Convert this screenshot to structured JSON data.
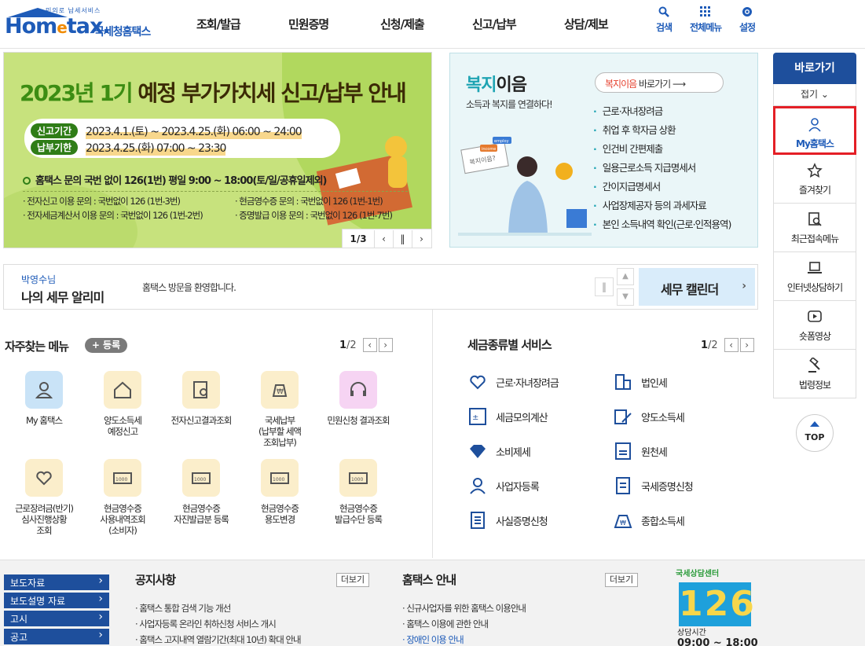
{
  "header": {
    "logo_word_a": "Hom",
    "logo_word_e": "e",
    "logo_word_b": "tax.",
    "logo_tagline": "민의로 납세서비스",
    "logo_ko": "국세청홈택스",
    "gnb": [
      "조회/발급",
      "민원증명",
      "신청/제출",
      "신고/납부",
      "상담/제보"
    ],
    "util": [
      {
        "label": "검색",
        "icon": "search-icon"
      },
      {
        "label": "전체메뉴",
        "icon": "grid-icon"
      },
      {
        "label": "설정",
        "icon": "gear-icon"
      }
    ]
  },
  "banner": {
    "headline_a": "2023년 1기",
    "headline_b": " 예정 부가가치세 신고/납부 안내",
    "report_label": "신고기간",
    "report_value": "2023.4.1.(토) ~ 2023.4.25.(화) 06:00 ~ 24:00",
    "pay_label": "납부기한",
    "pay_value": "2023.4.25.(화) 07:00 ~ 23:30",
    "contact": "홈택스 문의 국번 없이 126(1번) 평일 9:00 ~ 18:00(토/일/공휴일제외)",
    "lines": [
      "· 전자신고 이용 문의 : 국번없이 126 (1번-3번)",
      "· 현금영수증 문의 : 국번없이 126 (1번-1번)",
      "· 전자세금계산서 이용 문의 : 국번없이 126 (1번-2번)",
      "· 증명발급 이용 문의 : 국번없이 126 (1번-7번)"
    ],
    "page_current": "1",
    "page_total": "/3"
  },
  "welfare": {
    "title_a": "복지",
    "title_b": "이음",
    "subtitle": "소득과 복지를 연결하다!",
    "go_red": "복지이음",
    "go_rest": " 바로가기 ⟶",
    "items": [
      "근로·자녀장려금",
      "취업 후 학자금 상환",
      "인건비 간편제출",
      "일용근로소득 지급명세서",
      "간이지급명세서",
      "사업장제공자 등의 과세자료",
      "본인 소득내역 확인(근로·인적용역)"
    ],
    "illus_sign": "복지이음?",
    "illus_tag1": "employ",
    "illus_tag2": "income"
  },
  "notice": {
    "user": "박영수님",
    "title": "나의 세무 알리미",
    "message": "홈택스 방문을 환영합니다.",
    "calendar": "세무 캘린더"
  },
  "favorites": {
    "title": "자주찾는 메뉴",
    "register": "+ 등록",
    "page_current": "1",
    "page_total": "/2",
    "tiles": [
      "My 홈택스",
      "양도소득세\n예정신고",
      "전자신고결과조회",
      "국세납부\n(납부할 세액\n조회납부)",
      "민원신청 결과조회",
      "근로장려금(반기)\n심사진행상황\n조회",
      "현금영수증\n사용내역조회\n(소비자)",
      "현금영수증\n자진발급분 등록",
      "현금영수증\n용도변경",
      "현금영수증\n발급수단 등록"
    ]
  },
  "taxes": {
    "title": "세금종류별 서비스",
    "page_current": "1",
    "page_total": "/2",
    "items": [
      "근로·자녀장려금",
      "법인세",
      "세금모의계산",
      "양도소득세",
      "소비제세",
      "원천세",
      "사업자등록",
      "국세증명신청",
      "사실증명신청",
      "종합소득세"
    ]
  },
  "quick": {
    "head": "바로가기",
    "fold": "접기 ⌄",
    "items": [
      "My홈택스",
      "즐겨찾기",
      "최근접속메뉴",
      "인터넷상담하기",
      "숏폼영상",
      "법령정보"
    ],
    "top": "TOP"
  },
  "footer": {
    "links": [
      "보도자료",
      "보도설명 자료",
      "고시",
      "공고"
    ],
    "notice_title": "공지사항",
    "notice_more": "더보기",
    "notice_items": [
      "홈택스 통합 검색 기능 개선",
      "사업자등록 온라인 취하신청 서비스 개시",
      "홈택스 고지내역 열람기간(최대 10년) 확대 안내"
    ],
    "guide_title": "홈택스 안내",
    "guide_more": "더보기",
    "guide_items": [
      "신규사업자를 위한 홈택스 이용안내",
      "홈택스 이용에 관한 안내",
      "장애인 이용 안내"
    ],
    "center_label": "국세상담센터",
    "center_number": "126",
    "center_hours_label": "상담시간",
    "center_hours": "09:00 ~ 18:00"
  }
}
